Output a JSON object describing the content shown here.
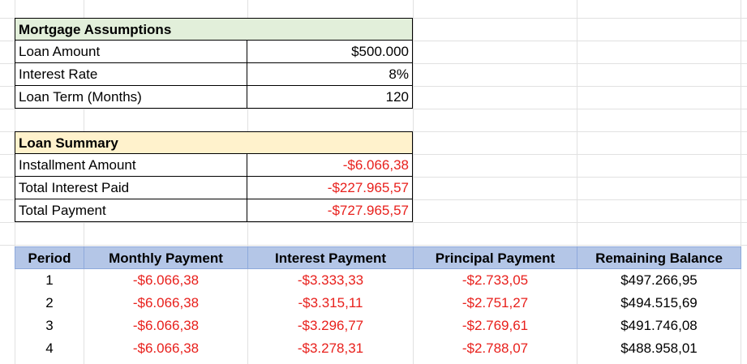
{
  "assumptions": {
    "title": "Mortgage Assumptions",
    "rows": [
      {
        "label": "Loan Amount",
        "value": "$500.000"
      },
      {
        "label": "Interest Rate",
        "value": "8%"
      },
      {
        "label": "Loan Term (Months)",
        "value": "120"
      }
    ]
  },
  "summary": {
    "title": "Loan Summary",
    "rows": [
      {
        "label": "Installment Amount",
        "value": "-$6.066,38"
      },
      {
        "label": "Total Interest Paid",
        "value": "-$227.965,57"
      },
      {
        "label": "Total Payment",
        "value": "-$727.965,57"
      }
    ]
  },
  "schedule": {
    "headers": [
      "Period",
      "Monthly Payment",
      "Interest Payment",
      "Principal Payment",
      "Remaining Balance"
    ],
    "rows": [
      [
        "1",
        "-$6.066,38",
        "-$3.333,33",
        "-$2.733,05",
        "$497.266,95"
      ],
      [
        "2",
        "-$6.066,38",
        "-$3.315,11",
        "-$2.751,27",
        "$494.515,69"
      ],
      [
        "3",
        "-$6.066,38",
        "-$3.296,77",
        "-$2.769,61",
        "$491.746,08"
      ],
      [
        "4",
        "-$6.066,38",
        "-$3.278,31",
        "-$2.788,07",
        "$488.958,01"
      ]
    ]
  },
  "colors": {
    "negative_text": "#e8201c",
    "assumptions_header_bg": "#e2efda",
    "summary_header_bg": "#fff2cc",
    "schedule_header_bg": "#b4c6e7"
  }
}
